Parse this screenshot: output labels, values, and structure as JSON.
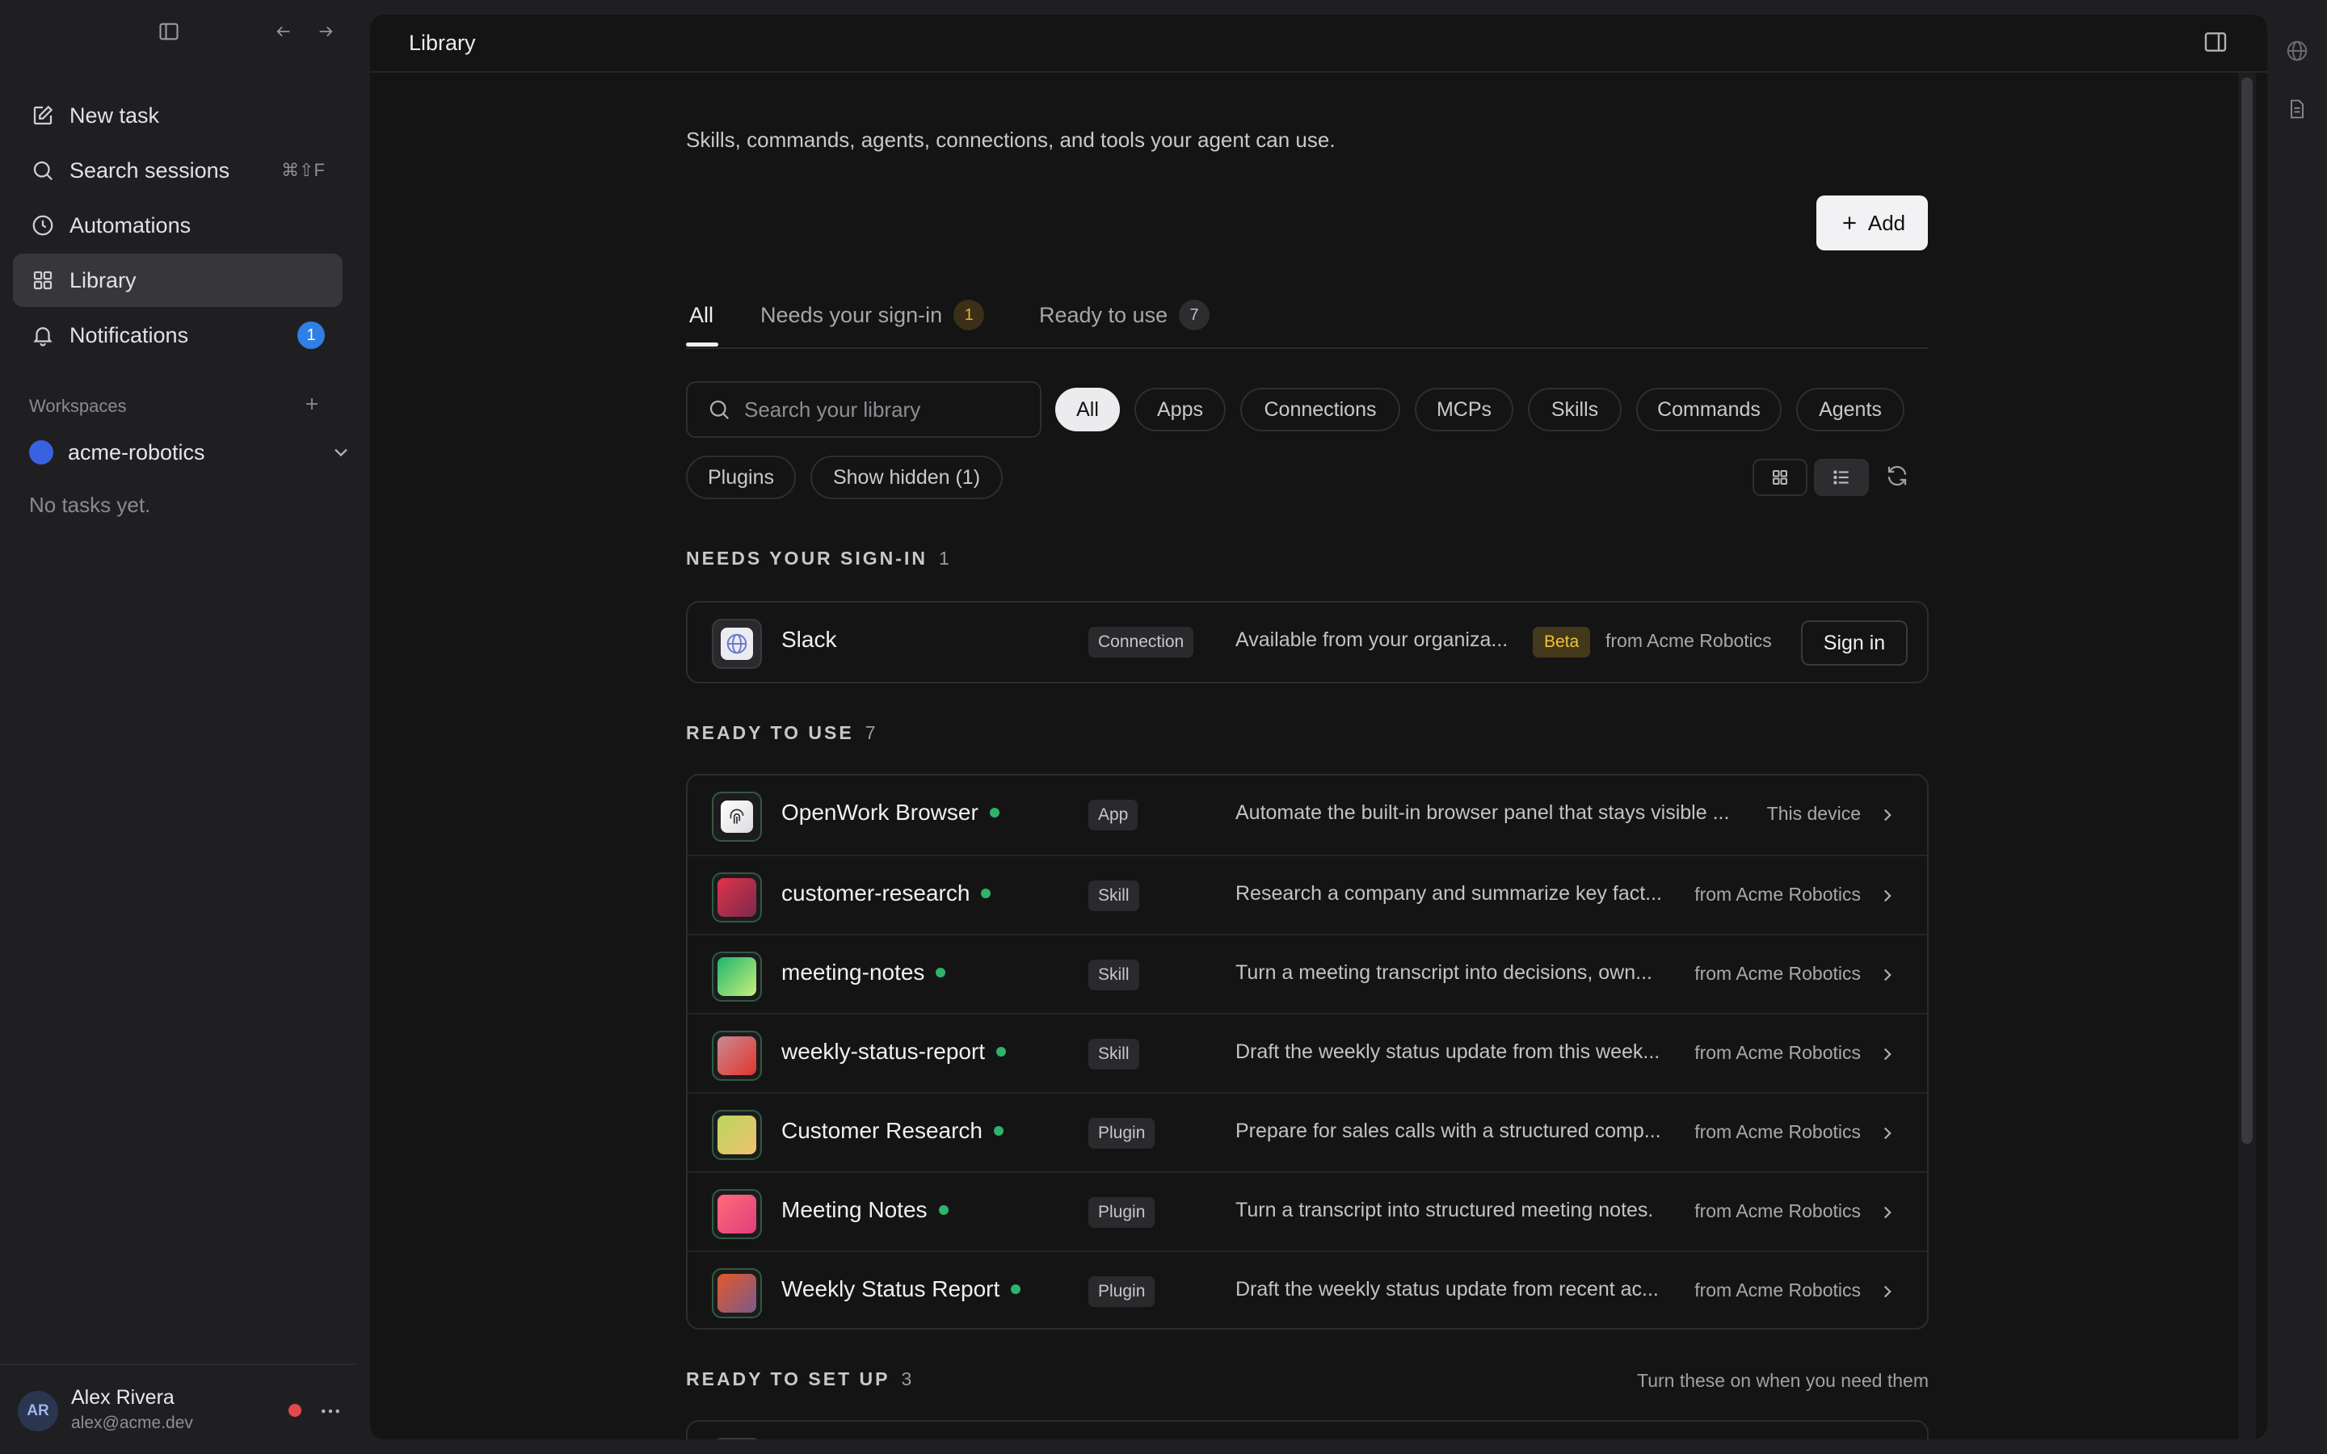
{
  "sidebar": {
    "nav": [
      {
        "label": "New task",
        "icon": "edit-icon"
      },
      {
        "label": "Search sessions",
        "icon": "search-icon",
        "shortcut": "⌘⇧F"
      },
      {
        "label": "Automations",
        "icon": "clock-icon"
      },
      {
        "label": "Library",
        "icon": "grid-icon",
        "active": true
      },
      {
        "label": "Notifications",
        "icon": "bell-icon",
        "badge": "1"
      }
    ],
    "workspaces_label": "Workspaces",
    "workspace": {
      "name": "acme-robotics",
      "color": "#3a62e0"
    },
    "empty_text": "No tasks yet.",
    "user": {
      "initials": "AR",
      "name": "Alex Rivera",
      "email": "alex@acme.dev"
    }
  },
  "main": {
    "title": "Library",
    "description": "Skills, commands, agents, connections, and tools your agent can use.",
    "add_label": "Add",
    "tabs": [
      {
        "label": "All",
        "active": true
      },
      {
        "label": "Needs your sign-in",
        "count": "1"
      },
      {
        "label": "Ready to use",
        "count": "7"
      }
    ],
    "search_placeholder": "Search your library",
    "filters": [
      "All",
      "Apps",
      "Connections",
      "MCPs",
      "Skills",
      "Commands",
      "Agents",
      "Plugins",
      "Show hidden (1)"
    ],
    "sections": {
      "signin": {
        "title": "NEEDS YOUR SIGN-IN",
        "count": "1"
      },
      "ready": {
        "title": "READY TO USE",
        "count": "7"
      },
      "setup": {
        "title": "READY TO SET UP",
        "count": "3",
        "hint": "Turn these on when you need them"
      }
    },
    "signin_item": {
      "name": "Slack",
      "type": "Connection",
      "desc": "Available from your organiza...",
      "badge": "Beta",
      "source": "from Acme Robotics",
      "action": "Sign in"
    },
    "ready_items": [
      {
        "name": "OpenWork Browser",
        "type": "App",
        "desc": "Automate the built-in browser panel that stays visible ...",
        "source": "This device"
      },
      {
        "name": "customer-research",
        "type": "Skill",
        "desc": "Research a company and summarize key fact...",
        "source": "from Acme Robotics"
      },
      {
        "name": "meeting-notes",
        "type": "Skill",
        "desc": "Turn a meeting transcript into decisions, own...",
        "source": "from Acme Robotics"
      },
      {
        "name": "weekly-status-report",
        "type": "Skill",
        "desc": "Draft the weekly status update from this week...",
        "source": "from Acme Robotics"
      },
      {
        "name": "Customer Research",
        "type": "Plugin",
        "desc": "Prepare for sales calls with a structured comp...",
        "source": "from Acme Robotics"
      },
      {
        "name": "Meeting Notes",
        "type": "Plugin",
        "desc": "Turn a transcript into structured meeting notes.",
        "source": "from Acme Robotics"
      },
      {
        "name": "Weekly Status Report",
        "type": "Plugin",
        "desc": "Draft the weekly status update from recent ac...",
        "source": "from Acme Robotics"
      }
    ],
    "icon_gradients": [
      "linear-gradient(135deg,#ffffff,#dcdce0)",
      "linear-gradient(135deg,#e0334a,#7a2a4a)",
      "linear-gradient(135deg,#1fb56e,#c8f07a)",
      "linear-gradient(135deg,#c88a90,#e2362e)",
      "linear-gradient(135deg,#b8d85a,#f0c070)",
      "linear-gradient(135deg,#ff6a7a,#e0407a)",
      "linear-gradient(135deg,#e25a2a,#7a5a8a)"
    ],
    "colors": {
      "accent_ok": "#2fb36a",
      "beta": "#f0c33a",
      "badge_blue": "#2f7fe6",
      "status_red": "#e5484d"
    }
  }
}
